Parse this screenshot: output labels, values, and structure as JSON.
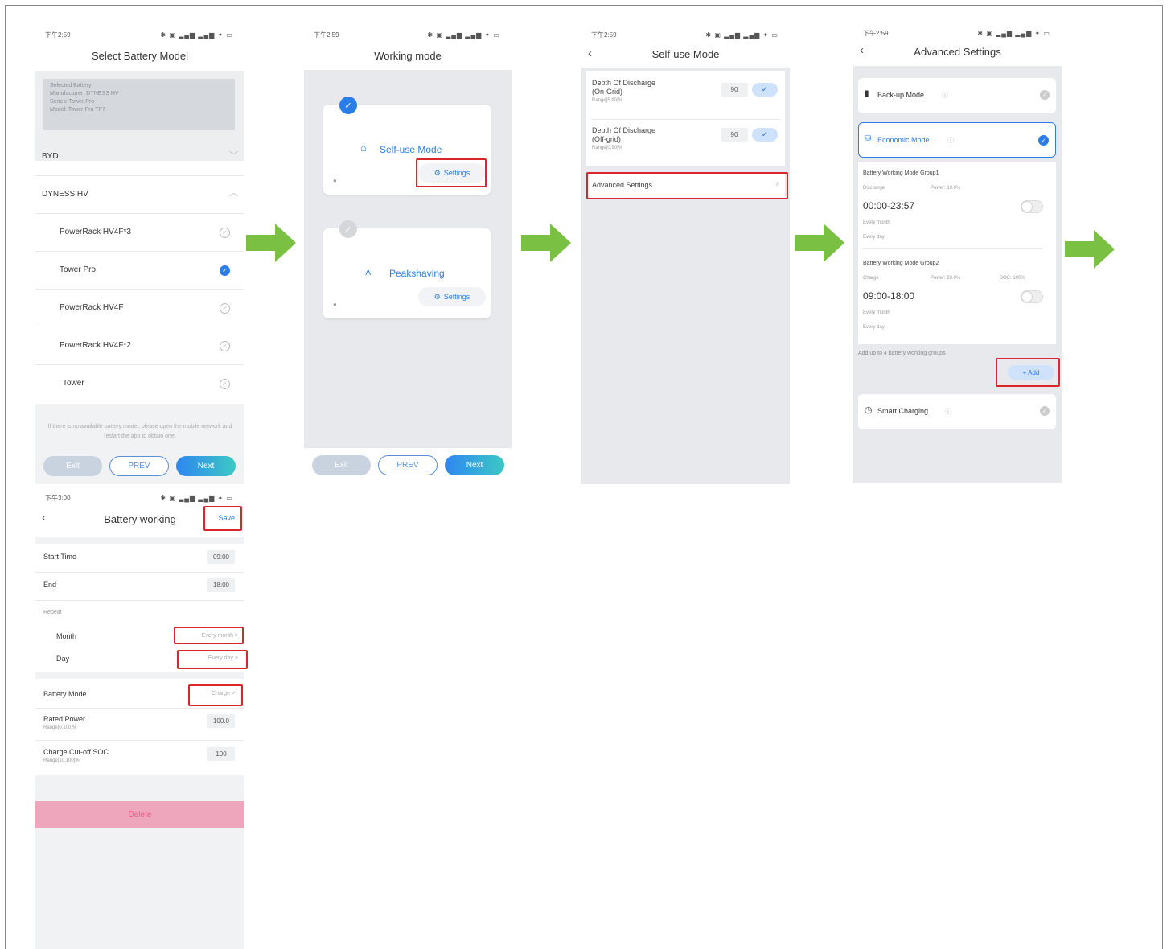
{
  "colors": {
    "accent": "#2b7de9",
    "highlight": "#d9262c",
    "arrow": "#7ac143",
    "delete": "#eea6bd"
  },
  "status_bar": {
    "time1": "下午2:59",
    "time2": "下午3:00",
    "icons": "✱ ▣ ▂▄▆ ▂▄▆ ✦ ▭"
  },
  "screen1": {
    "title": "Select Battery Model",
    "selected": {
      "heading": "Selected Battery",
      "manufacturer": "Manufacturer:  DYNESS HV",
      "series": "Series:   Tower Pro",
      "model": "Model:   Tower Pro TP7"
    },
    "brands": [
      {
        "label": "BYD"
      },
      {
        "label": "DYNESS HV"
      }
    ],
    "models": [
      {
        "label": "PowerRack HV4F*3",
        "selected": false
      },
      {
        "label": "Tower Pro",
        "selected": true
      },
      {
        "label": "PowerRack HV4F",
        "selected": false
      },
      {
        "label": "PowerRack HV4F*2",
        "selected": false
      },
      {
        "label": "Tower",
        "selected": false
      }
    ],
    "note": "If there is no available battery model, please open the mobile network and restart the app to obtain one.",
    "buttons": {
      "exit": "Exit",
      "prev": "PREV",
      "next": "Next"
    }
  },
  "screen2": {
    "title": "Working mode",
    "modes": [
      {
        "label": "Self-use Mode",
        "settings": "Settings",
        "checked": true
      },
      {
        "label": "Peakshaving",
        "settings": "Settings",
        "checked": false
      }
    ],
    "buttons": {
      "exit": "Exit",
      "prev": "PREV",
      "next": "Next"
    }
  },
  "screen3": {
    "title": "Self-use Mode",
    "rows": [
      {
        "label1": "Depth Of Discharge",
        "label2": "(On-Grid)",
        "range": "Range[5,90]%",
        "value": "90"
      },
      {
        "label1": "Depth Of Discharge",
        "label2": "(Off-grid)",
        "range": "Range[0,90]%",
        "value": "90"
      }
    ],
    "advanced": "Advanced Settings"
  },
  "screen4": {
    "title": "Advanced Settings",
    "backup": "Back-up Mode",
    "economic": "Economic Mode",
    "groups": [
      {
        "title": "Battery Working Mode Group1",
        "mode": "Discharge",
        "power": "Power: 10.0%",
        "soc": "",
        "time": "00:00-23:57",
        "month": "Every month",
        "day": "Every day"
      },
      {
        "title": "Battery Working Mode Group2",
        "mode": "Charge",
        "power": "Power: 20.0%",
        "soc": "SOC: 100%",
        "time": "09:00-18:00",
        "month": "Every month",
        "day": "Every day"
      }
    ],
    "add_note": "Add up to 4 battery working groups",
    "add_button": "+ Add",
    "smart": "Smart Charging"
  },
  "screen5": {
    "title": "Battery working",
    "save": "Save",
    "start_label": "Start Time",
    "start_value": "09:00",
    "end_label": "End",
    "end_value": "18:00",
    "repeat_label": "Repeat",
    "month_label": "Month",
    "month_value": "Every month >",
    "day_label": "Day",
    "day_value": "Every day >",
    "battery_mode_label": "Battery Mode",
    "battery_mode_value": "Charge >",
    "rated_power_label": "Rated Power",
    "rated_power_range": "Range[0,100]%",
    "rated_power_value": "100.0",
    "cutoff_label": "Charge Cut-off SOC",
    "cutoff_range": "Range[10,100]%",
    "cutoff_value": "100",
    "delete": "Delete"
  }
}
